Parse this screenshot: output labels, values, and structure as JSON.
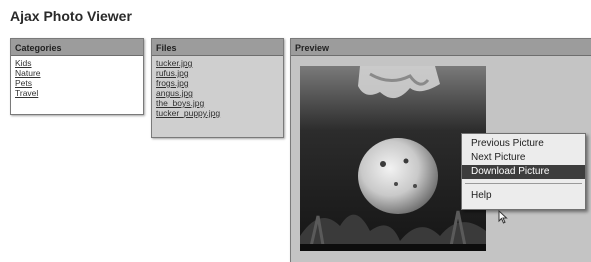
{
  "app": {
    "title": "Ajax Photo Viewer"
  },
  "categories": {
    "header": "Categories",
    "items": [
      "Kids",
      "Nature",
      "Pets",
      "Travel"
    ]
  },
  "files": {
    "header": "Files",
    "items": [
      "tucker.jpg",
      "rufus.jpg",
      "frogs.jpg",
      "angus.jpg",
      "the_boys.jpg",
      "tucker_puppy.jpg"
    ]
  },
  "preview": {
    "header": "Preview"
  },
  "context_menu": {
    "items": [
      "Previous Picture",
      "Next Picture",
      "Download Picture",
      "Help"
    ],
    "selected": "Download Picture"
  },
  "colors": {
    "panel_header": "#9c9c9c",
    "menu_selected": "#3d3d3d",
    "files_bg": "#cfcfcf",
    "preview_bg": "#c4c4c4"
  },
  "icons": {
    "cursor": "arrow-cursor-icon"
  }
}
